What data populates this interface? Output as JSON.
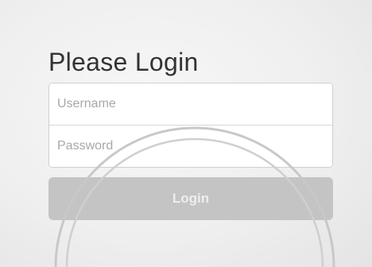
{
  "login": {
    "title": "Please Login",
    "username_placeholder": "Username",
    "password_placeholder": "Password",
    "submit_label": "Login"
  },
  "colors": {
    "background": "#efefef",
    "button_disabled": "#c4c4c4",
    "arc_stroke": "#c8c8c8"
  }
}
